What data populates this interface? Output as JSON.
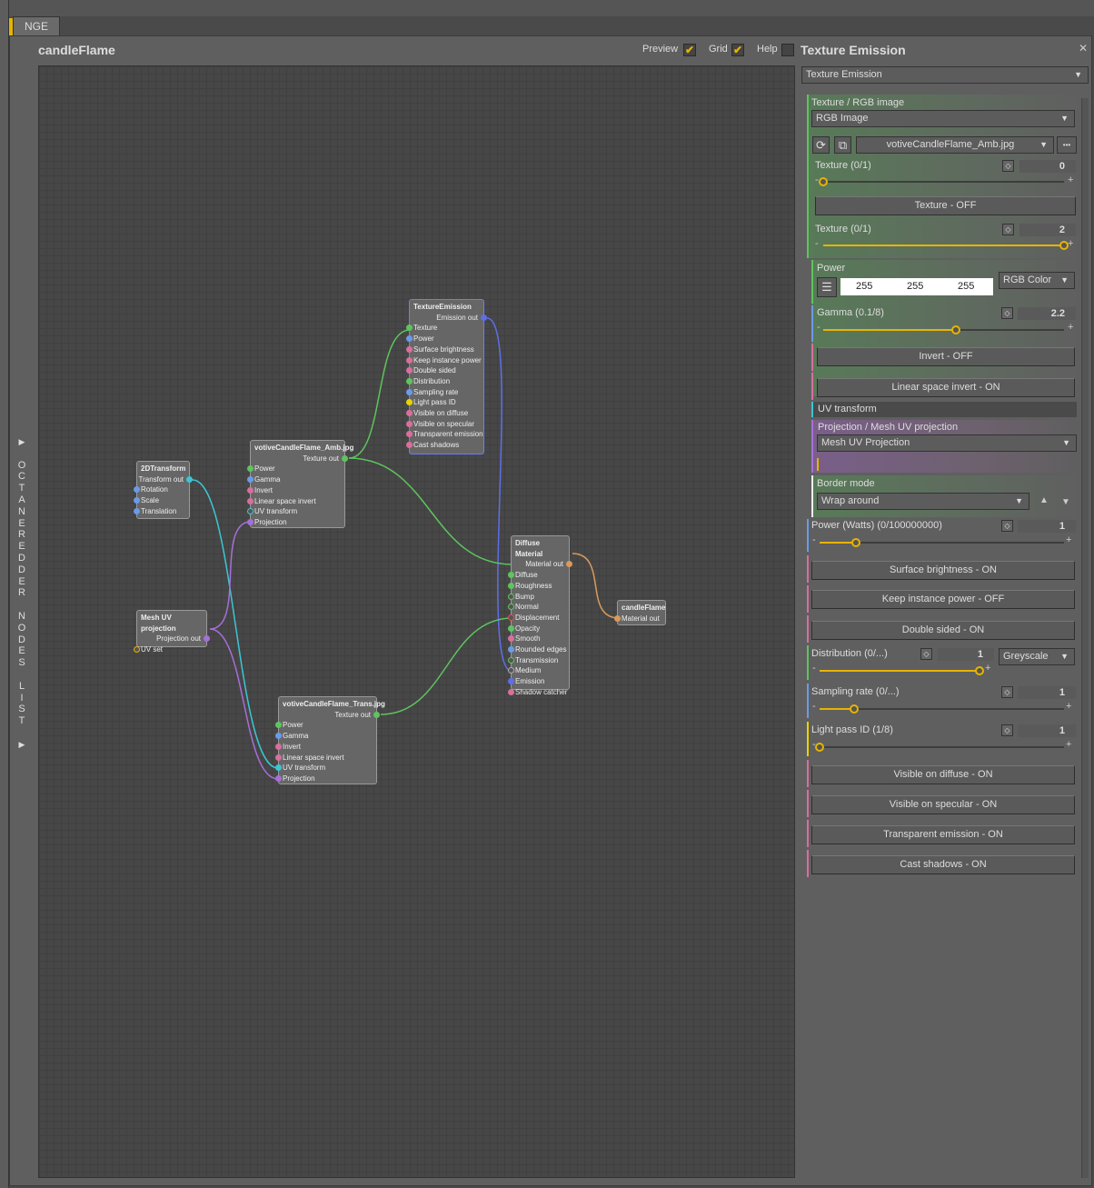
{
  "window": {
    "tab_label": "NGE"
  },
  "sidebar_label_chars": [
    "▶",
    "",
    "O",
    "C",
    "T",
    "A",
    "N",
    "E",
    "R",
    "E",
    "D",
    "D",
    "E",
    "R",
    "",
    "N",
    "O",
    "D",
    "E",
    "S",
    "",
    "L",
    "I",
    "S",
    "T",
    "",
    "▶"
  ],
  "header": {
    "title": "candleFlame",
    "preview_label": "Preview",
    "grid_label": "Grid",
    "help_label": "Help",
    "check_mark": "✔"
  },
  "nodes": {
    "transform2d": {
      "title": "2DTransform",
      "output": "Transform out",
      "inputs": [
        "Rotation",
        "Scale",
        "Translation"
      ]
    },
    "mesh_uv": {
      "title": "Mesh UV projection",
      "output": "Projection out",
      "inputs": [
        "UV set"
      ]
    },
    "amb_image": {
      "title": "votiveCandleFlame_Amb.jpg",
      "output": "Texture out",
      "inputs": [
        "Power",
        "Gamma",
        "Invert",
        "Linear space invert",
        "UV transform",
        "Projection"
      ]
    },
    "trans_image": {
      "title": "votiveCandleFlame_Trans.jpg",
      "output": "Texture out",
      "inputs": [
        "Power",
        "Gamma",
        "Invert",
        "Linear space invert",
        "UV transform",
        "Projection"
      ]
    },
    "texture_emission": {
      "title": "TextureEmission",
      "output": "Emission out",
      "inputs": [
        "Texture",
        "Power",
        "Surface brightness",
        "Keep instance power",
        "Double sided",
        "Distribution",
        "Sampling rate",
        "Light pass ID",
        "Visible on diffuse",
        "Visible on specular",
        "Transparent emission",
        "Cast shadows"
      ]
    },
    "diffuse": {
      "title": "Diffuse Material",
      "output": "Material out",
      "inputs": [
        "Diffuse",
        "Roughness",
        "Bump",
        "Normal",
        "Displacement",
        "Opacity",
        "Smooth",
        "Rounded edges",
        "Transmission",
        "Medium",
        "Emission",
        "Shadow catcher"
      ]
    },
    "candle": {
      "title": "candleFlame",
      "output": "Material out"
    }
  },
  "panel": {
    "title": "Texture Emission",
    "node_select": "Texture Emission",
    "texture_label": "Texture / RGB image",
    "texture_mode": "RGB Image",
    "reload_icon": "⟳",
    "open_icon": "⧉",
    "file_name": "votiveCandleFlame_Amb.jpg",
    "more_icon": "•••",
    "texture1_label": "Texture (0/1)",
    "texture1_value": "0",
    "texture1_frac": 0.0,
    "texture_off_btn": "Texture - OFF",
    "texture2_label": "Texture (0/1)",
    "texture2_value": "2",
    "texture2_frac": 1.0,
    "power_label": "Power",
    "list_icon": "☰",
    "rgb": [
      "255",
      "255",
      "255"
    ],
    "rgb_mode": "RGB Color",
    "gamma_label": "Gamma (0.1/8)",
    "gamma_value": "2.2",
    "gamma_frac": 0.55,
    "invert_btn": "Invert - OFF",
    "linear_btn": "Linear space invert - ON",
    "uv_transform_label": "UV transform",
    "projection_label": "Projection / Mesh UV projection",
    "projection_mode": "Mesh UV Projection",
    "border_label": "Border mode",
    "border_mode": "Wrap around",
    "up_icon": "▲",
    "down_icon": "▼",
    "power_watts_label": "Power (Watts) (0/100000000)",
    "power_watts_value": "1",
    "power_watts_frac": 0.15,
    "surface_btn": "Surface brightness - ON",
    "keep_btn": "Keep instance power - OFF",
    "double_btn": "Double sided - ON",
    "distribution_label": "Distribution (0/...)",
    "distribution_value": "1",
    "distribution_frac": 1.0,
    "distribution_mode": "Greyscale",
    "sampling_label": "Sampling rate (0/...)",
    "sampling_value": "1",
    "sampling_frac": 0.14,
    "lightpass_label": "Light pass ID (1/8)",
    "lightpass_value": "1",
    "lightpass_frac": 0.0,
    "vis_diffuse_btn": "Visible on diffuse - ON",
    "vis_specular_btn": "Visible on specular - ON",
    "transparent_btn": "Transparent emission - ON",
    "cast_btn": "Cast shadows - ON"
  }
}
